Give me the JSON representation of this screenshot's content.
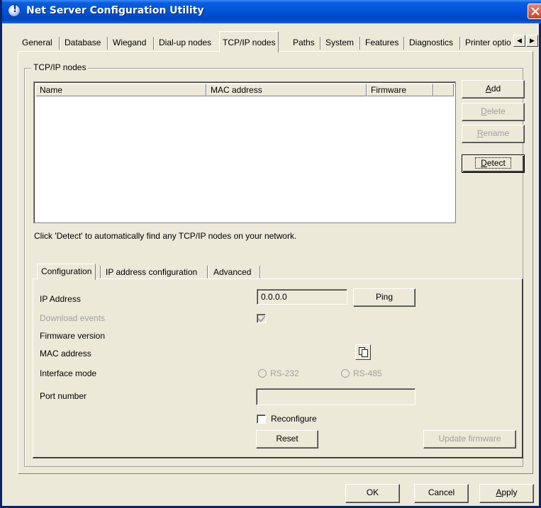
{
  "window": {
    "title": "Net Server Configuration Utility"
  },
  "tabs": [
    {
      "label": "General"
    },
    {
      "label": "Database"
    },
    {
      "label": "Wiegand"
    },
    {
      "label": "Dial-up nodes"
    },
    {
      "label": "TCP/IP nodes",
      "active": true
    },
    {
      "label": "Paths"
    },
    {
      "label": "System"
    },
    {
      "label": "Features"
    },
    {
      "label": "Diagnostics"
    },
    {
      "label": "Printer optio"
    }
  ],
  "group": {
    "title": "TCP/IP nodes"
  },
  "list": {
    "columns": [
      "Name",
      "MAC address",
      "Firmware"
    ],
    "rows": []
  },
  "side_buttons": {
    "add": {
      "label": "Add",
      "accel": "A",
      "rest": "dd"
    },
    "delete": {
      "label": "Delete",
      "accel": "D",
      "rest": "elete"
    },
    "rename": {
      "label": "Rename",
      "accel": "R",
      "rest": "ename"
    },
    "detect": {
      "label": "Detect",
      "accel": "D",
      "rest": "etect"
    }
  },
  "hint": "Click 'Detect' to automatically find any TCP/IP nodes on your network.",
  "inner_tabs": [
    {
      "label": "Configuration",
      "active": true
    },
    {
      "label": "IP address configuration"
    },
    {
      "label": "Advanced"
    }
  ],
  "config": {
    "ip_label": "IP Address",
    "ip_value": "0.0.0.0",
    "ping_label": "Ping",
    "download_events_label": "Download events",
    "download_events_checked": true,
    "firmware_version_label": "Firmware version",
    "mac_address_label": "MAC address",
    "copy_icon": "copy-icon",
    "interface_mode_label": "Interface mode",
    "rs232_label": "RS-232",
    "rs485_label": "RS-485",
    "port_number_label": "Port number",
    "port_number_value": "",
    "reconfigure_label": "Reconfigure",
    "reconfigure_checked": false,
    "reset_label": "Reset",
    "update_firmware_label": "Update firmware"
  },
  "footer": {
    "ok_label": "OK",
    "cancel_label": "Cancel",
    "apply_label": "Apply",
    "apply_accel": "A",
    "apply_rest": "pply"
  },
  "colors": {
    "titlebar": "#0052d6",
    "face": "#ece9d8",
    "close": "#c8452a"
  }
}
